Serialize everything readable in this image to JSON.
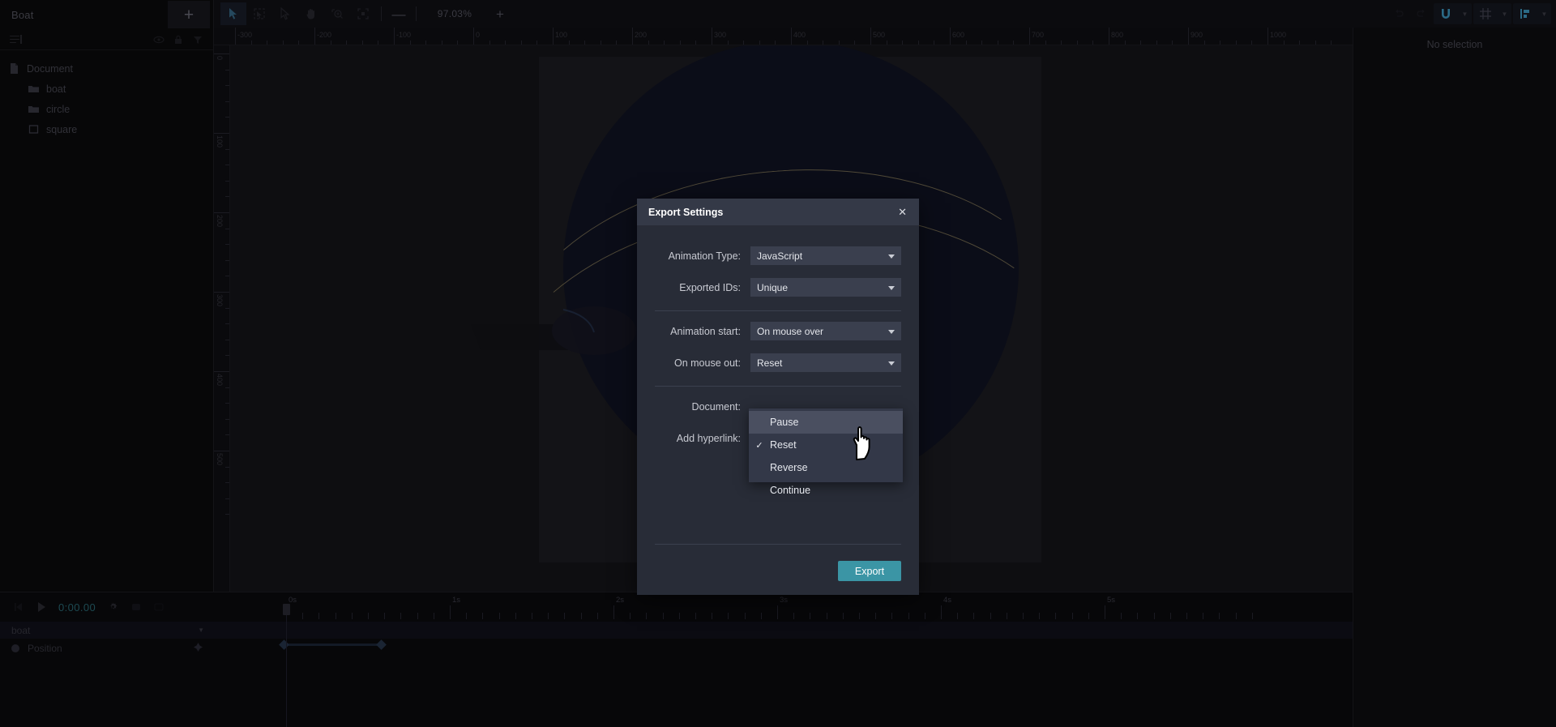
{
  "sidebar": {
    "title": "Boat",
    "add_label": "+",
    "tree": [
      {
        "label": "Document",
        "icon": "document-icon",
        "level": 0
      },
      {
        "label": "boat",
        "icon": "folder-icon",
        "level": 1
      },
      {
        "label": "circle",
        "icon": "folder-icon",
        "level": 1
      },
      {
        "label": "square",
        "icon": "square-icon",
        "level": 1
      }
    ]
  },
  "toolbar": {
    "tools": [
      {
        "name": "select-tool",
        "active": true
      },
      {
        "name": "transform-tool",
        "active": false
      },
      {
        "name": "direct-select-tool",
        "active": false
      },
      {
        "name": "hand-tool",
        "active": false
      },
      {
        "name": "zoom-tool",
        "active": false
      },
      {
        "name": "fit-screen-tool",
        "active": false
      }
    ],
    "zoom_out": "—",
    "zoom_value": "97.03%",
    "zoom_in": "+"
  },
  "right_panel": {
    "status": "No selection"
  },
  "rulers": {
    "horizontal": [
      "-300",
      "-200",
      "-100",
      "0",
      "100",
      "200",
      "300",
      "400",
      "500",
      "600",
      "700",
      "800",
      "900",
      "1000"
    ],
    "vertical": [
      "0",
      "100",
      "200",
      "300",
      "400",
      "500"
    ]
  },
  "timeline": {
    "time": "0:00.00",
    "ruler": [
      "0s",
      "1s",
      "2s",
      "3s",
      "4s",
      "5s"
    ],
    "track_name": "boat",
    "property_name": "Position"
  },
  "dialog": {
    "title": "Export Settings",
    "close_label": "✕",
    "fields": [
      {
        "label": "Animation Type:",
        "value": "JavaScript"
      },
      {
        "label": "Exported IDs:",
        "value": "Unique"
      },
      {
        "label": "Animation start:",
        "value": "On mouse over"
      },
      {
        "label": "On mouse out:",
        "value": "Reset"
      }
    ],
    "document_label": "Document:",
    "hyperlink_label": "Add hyperlink:",
    "export_button": "Export"
  },
  "dropdown": {
    "options": [
      {
        "label": "Pause",
        "checked": false,
        "highlighted": true
      },
      {
        "label": "Reset",
        "checked": true,
        "highlighted": false
      },
      {
        "label": "Reverse",
        "checked": false,
        "highlighted": false
      },
      {
        "label": "Continue",
        "checked": false,
        "highlighted": false
      }
    ],
    "check_glyph": "✓"
  },
  "colors": {
    "accent": "#3b95a5",
    "dialog_bg": "#282c37",
    "dialog_title_bg": "#343947",
    "menu_bg": "#333848",
    "menu_highlight": "#4a4f60"
  }
}
